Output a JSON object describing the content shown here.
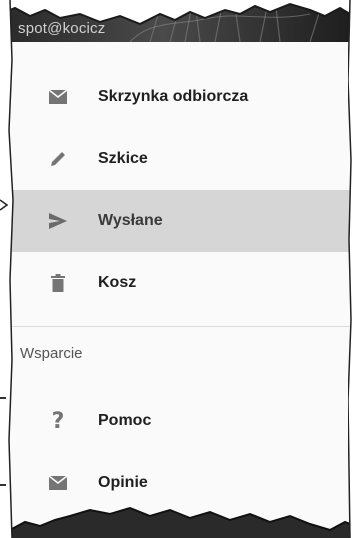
{
  "header": {
    "email": "spot@kocicz"
  },
  "menu": {
    "items": [
      {
        "icon": "inbox-icon",
        "label": "Skrzynka odbiorcza",
        "selected": false
      },
      {
        "icon": "pencil-icon",
        "label": "Szkice",
        "selected": false
      },
      {
        "icon": "send-icon",
        "label": "Wysłane",
        "selected": true
      },
      {
        "icon": "trash-icon",
        "label": "Kosz",
        "selected": false
      }
    ]
  },
  "support": {
    "title": "Wsparcie",
    "items": [
      {
        "icon": "help-icon",
        "label": "Pomoc"
      },
      {
        "icon": "feedback-icon",
        "label": "Opinie"
      }
    ]
  },
  "colors": {
    "selected_bg": "#d6d6d6",
    "icon": "#757575"
  }
}
